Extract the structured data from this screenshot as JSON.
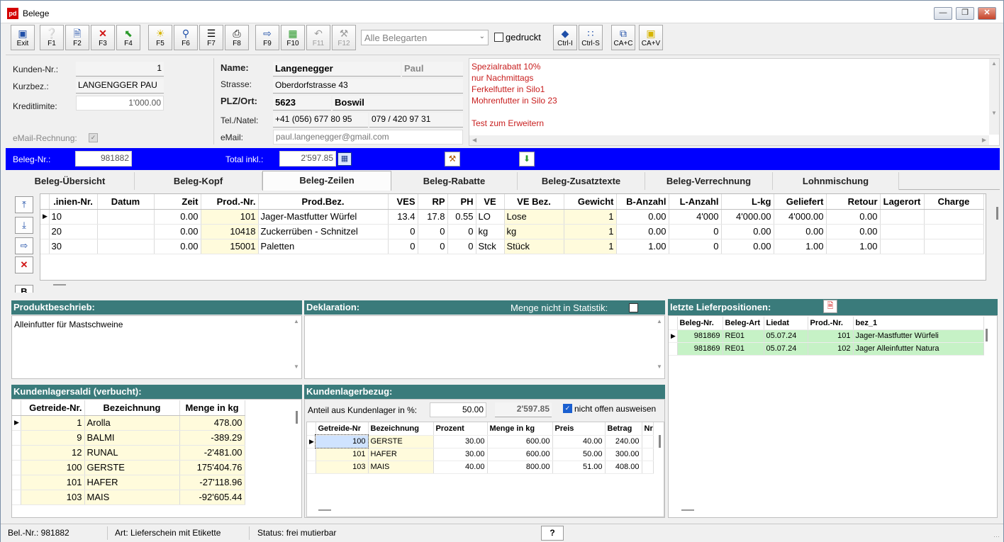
{
  "window": {
    "title": "Belege",
    "app_icon": "pd"
  },
  "toolbar": {
    "buttons": [
      {
        "name": "exit",
        "label": "Exit",
        "icon": "exit-door-icon"
      },
      {
        "name": "f1",
        "label": "F1",
        "icon": "help-icon"
      },
      {
        "name": "f2",
        "label": "F2",
        "icon": "new-document-icon"
      },
      {
        "name": "f3",
        "label": "F3",
        "icon": "delete-x-icon"
      },
      {
        "name": "f4",
        "label": "F4",
        "icon": "green-arrow-icon"
      },
      {
        "name": "f5",
        "label": "F5",
        "icon": "lightbulb-icon"
      },
      {
        "name": "f6",
        "label": "F6",
        "icon": "magnifier-icon"
      },
      {
        "name": "f7",
        "label": "F7",
        "icon": "list-icon"
      },
      {
        "name": "f8",
        "label": "F8",
        "icon": "printer-icon"
      },
      {
        "name": "f9",
        "label": "F9",
        "icon": "export-icon"
      },
      {
        "name": "f10",
        "label": "F10",
        "icon": "calculator-icon"
      },
      {
        "name": "f11",
        "label": "F11",
        "icon": "undo-icon"
      },
      {
        "name": "f12",
        "label": "F12",
        "icon": "hammer-icon"
      },
      {
        "name": "ctrl-i",
        "label": "Ctrl-I",
        "icon": "diamond-icon"
      },
      {
        "name": "ctrl-s",
        "label": "Ctrl-S",
        "icon": "tree-icon"
      },
      {
        "name": "ca-c",
        "label": "CA+C",
        "icon": "copy-icon"
      },
      {
        "name": "ca-v",
        "label": "CA+V",
        "icon": "paste-icon"
      }
    ],
    "belegart_value": "Alle Belegarten",
    "gedruckt_label": "gedruckt"
  },
  "customer": {
    "kunden_nr_label": "Kunden-Nr.:",
    "kunden_nr": "1",
    "kurzbez_label": "Kurzbez.:",
    "kurzbez": "LANGENGGER PAU",
    "kreditlimite_label": "Kreditlimite:",
    "kreditlimite": "1'000.00",
    "email_rechnung_label": "eMail-Rechnung:"
  },
  "address": {
    "name_label": "Name:",
    "name": "Langenegger",
    "firstname": "Paul",
    "strasse_label": "Strasse:",
    "strasse": "Oberdorfstrasse 43",
    "plz_label": "PLZ/Ort:",
    "plz": "5623",
    "ort": "Boswil",
    "tel_label": "Tel./Natel:",
    "tel": "+41 (056) 677 80 95",
    "natel": "079 / 420 97 31",
    "email_label": "eMail:",
    "email": "paul.langenegger@gmail.com"
  },
  "notes": [
    "Spezialrabatt 10%",
    "nur Nachmittags",
    "Ferkelfutter in Silo1",
    "Mohrenfutter in Silo 23",
    "",
    "Test zum Erweitern"
  ],
  "belegbar": {
    "beleg_nr_label": "Beleg-Nr.:",
    "beleg_nr": "981882",
    "total_label": "Total inkl.:",
    "total": "2'597.85"
  },
  "tabs": [
    "Beleg-Übersicht",
    "Beleg-Kopf",
    "Beleg-Zeilen",
    "Beleg-Rabatte",
    "Beleg-Zusatztexte",
    "Beleg-Verrechnung",
    "Lohnmischung"
  ],
  "grid": {
    "columns": [
      ".inien-Nr.",
      "Datum",
      "Zeit",
      "Prod.-Nr.",
      "Prod.Bez.",
      "VES",
      "RP",
      "PH",
      "VE",
      "VE Bez.",
      "Gewicht",
      "B-Anzahl",
      "L-Anzahl",
      "L-kg",
      "Geliefert",
      "Retour",
      "Lagerort",
      "Charge"
    ],
    "rows": [
      [
        "10",
        "",
        "0.00",
        "101",
        "Jager-Mastfutter Würfel",
        "13.4",
        "17.8",
        "0.55",
        "LO",
        "Lose",
        "1",
        "0.00",
        "4'000",
        "4'000.00",
        "4'000.00",
        "0.00",
        "",
        ""
      ],
      [
        "20",
        "",
        "0.00",
        "10418",
        "Zuckerrüben - Schnitzel",
        "0",
        "0",
        "0",
        "kg",
        "kg",
        "1",
        "0.00",
        "0",
        "0.00",
        "0.00",
        "0.00",
        "",
        ""
      ],
      [
        "30",
        "",
        "0.00",
        "15001",
        "Paletten",
        "0",
        "0",
        "0",
        "Stck",
        "Stück",
        "1",
        "1.00",
        "0",
        "0.00",
        "1.00",
        "1.00",
        "",
        ""
      ]
    ]
  },
  "produktbeschrieb": {
    "header": "Produktbeschrieb:",
    "text": "Alleinfutter für Mastschweine"
  },
  "deklaration": {
    "header": "Deklaration:",
    "menge_label": "Menge nicht in Statistik:"
  },
  "lieferpos": {
    "header": "letzte Lieferpositionen:",
    "columns": [
      "Beleg-Nr.",
      "Beleg-Art",
      "Liedat",
      "Prod.-Nr.",
      "bez_1"
    ],
    "rows": [
      [
        "981869",
        "RE01",
        "05.07.24",
        "101",
        "Jager-Mastfutter Würfeli"
      ],
      [
        "981869",
        "RE01",
        "05.07.24",
        "102",
        "Jager Alleinfutter Natura"
      ]
    ]
  },
  "lagersaldi": {
    "header": "Kundenlagersaldi (verbucht):",
    "columns": [
      "Getreide-Nr.",
      "Bezeichnung",
      "Menge in kg"
    ],
    "rows": [
      [
        "1",
        "Arolla",
        "478.00"
      ],
      [
        "9",
        "BALMI",
        "-389.29"
      ],
      [
        "12",
        "RUNAL",
        "-2'481.00"
      ],
      [
        "100",
        "GERSTE",
        "175'404.76"
      ],
      [
        "101",
        "HAFER",
        "-27'118.96"
      ],
      [
        "103",
        "MAIS",
        "-92'605.44"
      ]
    ]
  },
  "lagerbezug": {
    "header": "Kundenlagerbezug:",
    "anteil_label": "Anteil aus Kundenlager in %:",
    "anteil": "50.00",
    "betrag": "2'597.85",
    "nicht_offen_label": "nicht offen ausweisen",
    "columns": [
      "Getreide-Nr",
      "Bezeichnung",
      "Prozent",
      "Menge in kg",
      "Preis",
      "Betrag",
      "Nr."
    ],
    "rows": [
      [
        "100",
        "GERSTE",
        "30.00",
        "600.00",
        "40.00",
        "240.00",
        ""
      ],
      [
        "101",
        "HAFER",
        "30.00",
        "600.00",
        "50.00",
        "300.00",
        ""
      ],
      [
        "103",
        "MAIS",
        "40.00",
        "800.00",
        "51.00",
        "408.00",
        ""
      ]
    ]
  },
  "status": {
    "bel_nr": "Bel.-Nr.: 981882",
    "art": "Art: Lieferschein mit Etikette",
    "status": "Status: frei mutierbar",
    "help": "?"
  }
}
